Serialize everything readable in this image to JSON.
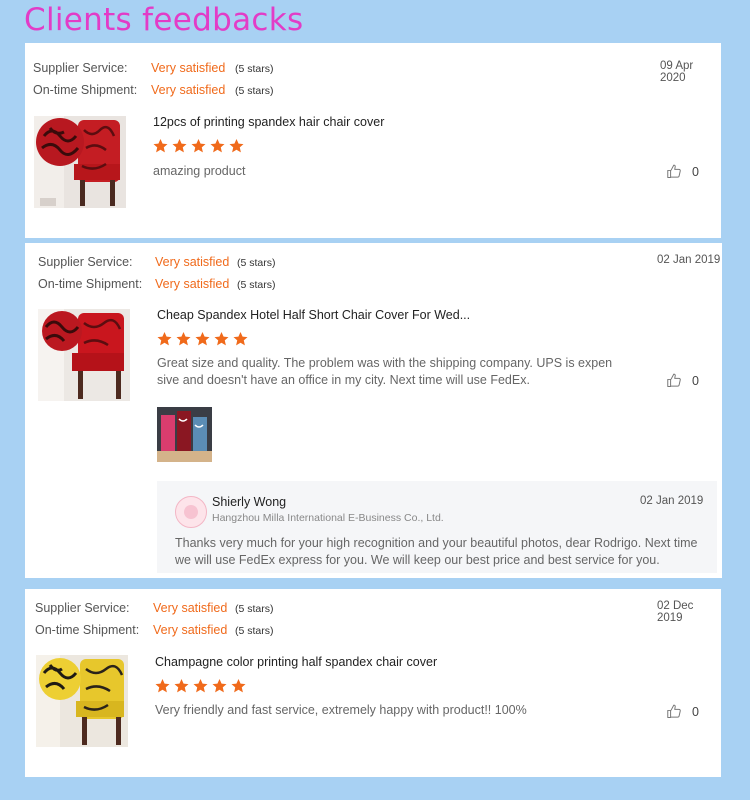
{
  "page": {
    "title": "Clients feedbacks"
  },
  "reviews": [
    {
      "supplier_label": "Supplier Service:",
      "supplier_value": "Very satisfied",
      "supplier_stars": "(5 stars)",
      "shipment_label": "On-time Shipment:",
      "shipment_value": "Very satisfied",
      "shipment_stars": "(5 stars)",
      "date": "09 Apr 2020",
      "product": "12pcs of printing spandex hair chair cover",
      "rating": 5,
      "text": "amazing product",
      "likes": "0"
    },
    {
      "supplier_label": "Supplier Service:",
      "supplier_value": "Very satisfied",
      "supplier_stars": "(5 stars)",
      "shipment_label": "On-time Shipment:",
      "shipment_value": "Very satisfied",
      "shipment_stars": "(5 stars)",
      "date": "02 Jan 2019",
      "product": "Cheap Spandex Hotel Half Short Chair Cover For Wed...",
      "rating": 5,
      "text_line1": "Great size and quality. The problem was with the shipping company. UPS is expen",
      "text_line2": "sive and doesn't have an office in my city. Next time will use FedEx.",
      "likes": "0",
      "reply": {
        "name": "Shierly Wong",
        "company": "Hangzhou Milla International E-Business Co., Ltd.",
        "date": "02 Jan 2019",
        "line1": "Thanks very much for your high recognition and your beautiful photos, dear Rodrigo. Next time",
        "line2": "we will use FedEx express for you. We will keep our best price and best service for you."
      }
    },
    {
      "supplier_label": "Supplier Service:",
      "supplier_value": "Very satisfied",
      "supplier_stars": "(5 stars)",
      "shipment_label": "On-time Shipment:",
      "shipment_value": "Very satisfied",
      "shipment_stars": "(5 stars)",
      "date": "02 Dec 2019",
      "product": "Champagne color printing half spandex chair cover",
      "rating": 5,
      "text": "Very friendly and fast service, extremely happy with product!! 100%",
      "likes": "0"
    }
  ],
  "colors": {
    "accent": "#f06a1b",
    "title": "#e23cc7",
    "background": "#a8d1f3"
  },
  "icons": {
    "rating": "star-icon",
    "like": "thumbs-up-icon",
    "avatar": "avatar"
  }
}
